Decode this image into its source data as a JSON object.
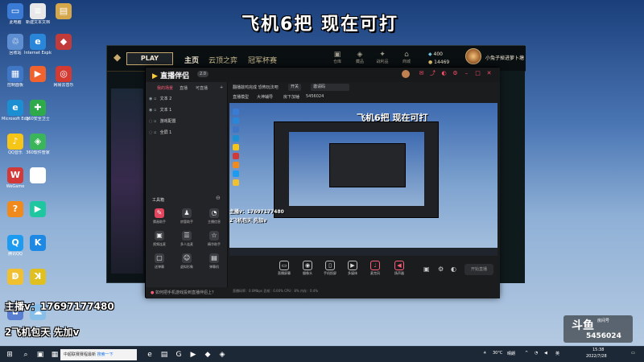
{
  "overlay": {
    "title": "飞机6把 现在可打",
    "streamer_line1": "主播v：17697177480",
    "streamer_line2": "2飞机包天 先加v"
  },
  "desktop_icons": [
    {
      "label": "此电脑",
      "glyph": "▭",
      "color": "#3a7bd5"
    },
    {
      "label": "新建文本文档",
      "glyph": "≡",
      "color": "#e8e8e8"
    },
    {
      "label": "",
      "glyph": "▤",
      "color": "#d6a64a"
    },
    {
      "label": "回收站",
      "glyph": "♲",
      "color": "#5d8ed1"
    },
    {
      "label": "Internet Explorer",
      "glyph": "e",
      "color": "#2a86d8"
    },
    {
      "label": "",
      "glyph": "◆",
      "color": "#c23b3b"
    },
    {
      "label": "控制面板",
      "glyph": "▦",
      "color": "#3f77c6"
    },
    {
      "label": "",
      "glyph": "▶",
      "color": "#f0622e"
    },
    {
      "label": "网易云音乐",
      "glyph": "◎",
      "color": "#d33a31"
    },
    {
      "label": "Microsoft Edge",
      "glyph": "e",
      "color": "#1c8fd2"
    },
    {
      "label": "360安全卫士",
      "glyph": "✚",
      "color": "#2faa4a"
    },
    {
      "label": "QQ音乐",
      "glyph": "♪",
      "color": "#f5c518"
    },
    {
      "label": "360软件管家",
      "glyph": "◈",
      "color": "#3bb55a"
    },
    {
      "label": "WeGame",
      "glyph": "W",
      "color": "#d23a3a"
    },
    {
      "label": "",
      "glyph": "◐",
      "color": "#ffffff"
    },
    {
      "label": "",
      "glyph": "?",
      "color": "#f08a1c"
    },
    {
      "label": "",
      "glyph": "▶",
      "color": "#1ec7a0"
    },
    {
      "label": "腾讯QQ",
      "glyph": "Q",
      "color": "#1d9bf0"
    },
    {
      "label": "",
      "glyph": "K",
      "color": "#1e88e5"
    },
    {
      "label": "",
      "glyph": "ↁ",
      "color": "#f0c030"
    },
    {
      "label": "",
      "glyph": "ꓘ",
      "color": "#e0c020"
    },
    {
      "label": "",
      "glyph": "✿",
      "color": "#5b7fd0"
    },
    {
      "label": "",
      "glyph": "☁",
      "color": "#87bfe8"
    }
  ],
  "game_client": {
    "play_label": "PLAY",
    "nav": [
      "主页",
      "云顶之弈",
      "冠军杯赛"
    ],
    "side_icons": [
      "仓库",
      "藏品",
      "战利品",
      "商城"
    ],
    "currency_be": "400",
    "currency_rp": "14469",
    "player_name": "小兔子掉进萝卜塘"
  },
  "stream_app": {
    "name": "直播伴侣",
    "version": "2.0",
    "tabs": [
      "我的场景",
      "直播",
      "可直播"
    ],
    "scenes": [
      "文本 2",
      "文本 1",
      "游戏配置",
      "全屏 1"
    ],
    "row1_label": "翻播敲鸡完成 恐怖玩法吧",
    "field1": "开关",
    "field2": "邀请码",
    "row2_a": "直播模型",
    "row2_b": "大神辅导",
    "row2_c": "房下加锤",
    "room_id": "5456024",
    "tools_title": "工具箱",
    "tools": [
      {
        "label": "猜画助手",
        "glyph": "✎",
        "hot": true
      },
      {
        "label": "房管助手",
        "glyph": "♟",
        "hot": false
      },
      {
        "label": "主播信息",
        "glyph": "◔",
        "hot": false
      },
      {
        "label": "视频连麦",
        "glyph": "▣",
        "hot": false
      },
      {
        "label": "多人连麦",
        "glyph": "☰",
        "hot": false
      },
      {
        "label": "精华助手",
        "glyph": "☆",
        "hot": false
      },
      {
        "label": "送弹幕",
        "glyph": "▢",
        "hot": false
      },
      {
        "label": "虚拟形象",
        "glyph": "☺",
        "hot": false
      },
      {
        "label": "弹幕机",
        "glyph": "▤",
        "hot": false
      }
    ],
    "bottom_hint": "如何把手机游戏投到直播伴侣上？",
    "controls": [
      "直播屏幕",
      "摄像头",
      "手机投屏",
      "多媒体",
      "麦克风",
      "扬声器"
    ],
    "start_label": "开始直播",
    "status_text": "直播码率：0.0Mbps  丢帧：0.00%  CPU：8%  内存：0.4%"
  },
  "preview": {
    "title": "飞机6把 现在可打",
    "streamer_line1": "主播v：17697177480",
    "streamer_line2": "2飞机包天 先加v"
  },
  "taskbar": {
    "search_text": "中超联赛赛程最新",
    "search_suffix": "搜索一下",
    "temperature": "30°C",
    "weather": "晴朗",
    "ime": "英",
    "time": "15:38",
    "date": "2022/7/28"
  },
  "douyu": {
    "logo": "斗鱼",
    "sub": "房间号",
    "room_id": "5456024"
  }
}
